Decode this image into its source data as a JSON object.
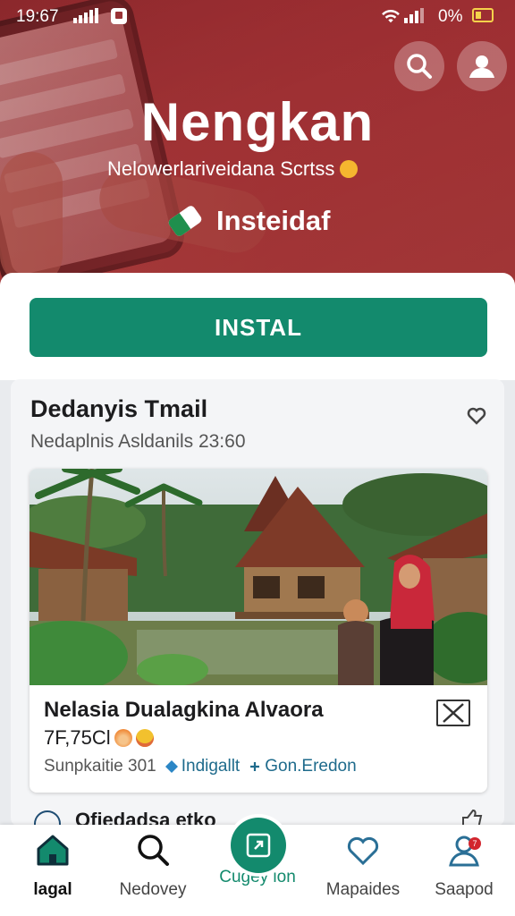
{
  "status_bar": {
    "time": "19:67",
    "battery": "0%"
  },
  "hero": {
    "title": "Nengkan",
    "subtitle": "Nelowerlariveidana Scrtss",
    "brand_name": "Insteidaf",
    "colors": {
      "hero": "#a93a3b",
      "accent": "#138a6d"
    },
    "icons": [
      "search-icon",
      "profile-icon",
      "brand-logo-icon"
    ]
  },
  "install": {
    "label": "INSTAL"
  },
  "section": {
    "title": "Dedanyis Tmail",
    "meta": "Nedaplnis Asldanils 23:60"
  },
  "listing": {
    "title": "Nelasia Dualagkina Alvaora",
    "price": "7F,75Cl",
    "meta": "Sunpkaitie 301",
    "tags": [
      "Indigallt",
      "Gon.Eredon"
    ]
  },
  "teaser": {
    "text": "Ofiedadsa etko"
  },
  "nav": {
    "home": "lagal",
    "discover": "Nedovey",
    "center": "Cugey ion",
    "favorites": "Mapaides",
    "support": "Saapod",
    "support_badge": "7"
  }
}
